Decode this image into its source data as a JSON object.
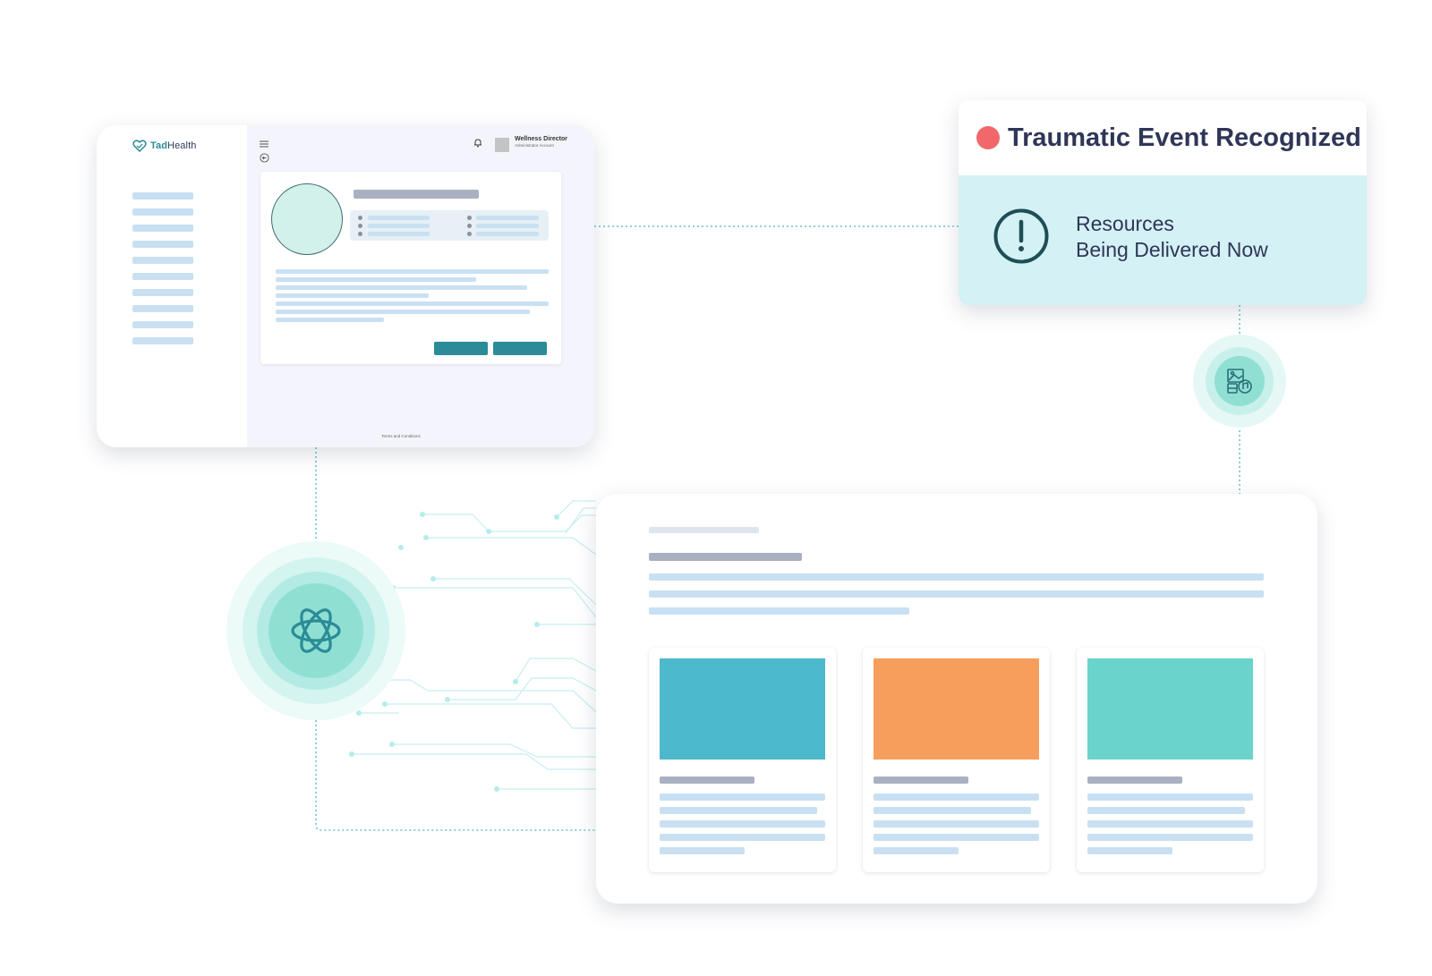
{
  "admin_window": {
    "logo": {
      "prefix": "Tad",
      "suffix": "Health"
    },
    "sidebar": {
      "item_count": 10
    },
    "user": {
      "name": "Wellness Director",
      "role": "Administrator Account"
    },
    "footer": {
      "terms": "Terms and Conditions"
    }
  },
  "alert": {
    "title": "Traumatic Event Recognized",
    "message_line1": "Resources",
    "message_line2": "Being Delivered Now",
    "status_color": "#f2686a"
  },
  "resources_window": {
    "cards": [
      {
        "color": "#4db9cc"
      },
      {
        "color": "#f69f5c"
      },
      {
        "color": "#6ad4ca"
      }
    ]
  },
  "icons": {
    "hub": "ai-atom-icon",
    "media": "media-resources-icon",
    "alert": "exclamation-circle-icon",
    "notification": "bell-icon"
  },
  "colors": {
    "accent": "#2b8c97",
    "connector": "#5fbcc4",
    "glow": "#8fe0d3"
  }
}
